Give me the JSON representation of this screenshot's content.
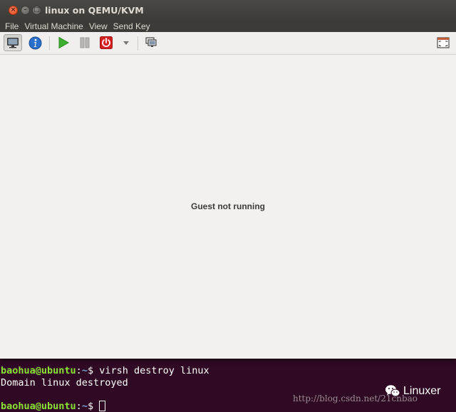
{
  "window": {
    "title": "linux on QEMU/KVM",
    "controls": [
      "close",
      "minimize",
      "maximize"
    ]
  },
  "menubar": {
    "items": [
      {
        "label": "File"
      },
      {
        "label": "Virtual Machine"
      },
      {
        "label": "View"
      },
      {
        "label": "Send Key"
      }
    ]
  },
  "toolbar": {
    "buttons": [
      {
        "name": "console-button",
        "icon": "monitor-icon",
        "active": true
      },
      {
        "name": "details-button",
        "icon": "info-icon",
        "active": false
      },
      {
        "name": "run-button",
        "icon": "play-icon",
        "active": false
      },
      {
        "name": "pause-button",
        "icon": "pause-icon",
        "active": false
      },
      {
        "name": "shutdown-button",
        "icon": "power-icon",
        "active": false
      },
      {
        "name": "snapshots-button",
        "icon": "snapshot-icon",
        "active": false
      },
      {
        "name": "fullscreen-button",
        "icon": "fullscreen-icon",
        "active": false
      }
    ],
    "colors": {
      "play": "#3cb02e",
      "info": "#2a6fc9",
      "power": "#d42020"
    }
  },
  "guest": {
    "status": "Guest not running"
  },
  "terminal": {
    "colors": {
      "background": "#300a24",
      "user": "#8ae234",
      "path": "#729fcf",
      "text": "#ffffff"
    },
    "lines": [
      {
        "user": "baohua@ubuntu",
        "sep": ":",
        "path": "~",
        "symbol": "$ ",
        "command": "virsh destroy linux"
      },
      {
        "output": "Domain linux destroyed"
      },
      {
        "user": "baohua@ubuntu",
        "sep": ":",
        "path": "~",
        "symbol": "$ ",
        "command": ""
      }
    ]
  },
  "watermark": {
    "url": "http://blog.csdn.net/21cnbao",
    "brand": "Linuxer",
    "brand_icon": "wechat-icon"
  }
}
